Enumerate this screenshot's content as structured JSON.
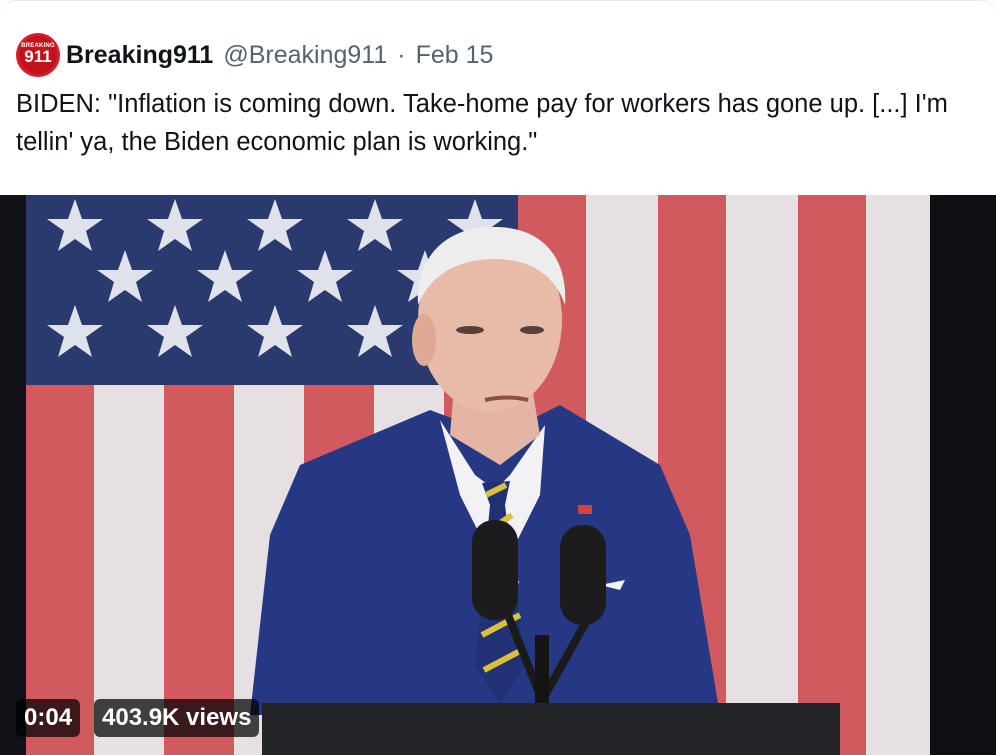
{
  "tweet": {
    "author_name": "Breaking911",
    "author_handle": "@Breaking911",
    "separator": "·",
    "date": "Feb 15",
    "avatar_top_text": "BREAKING",
    "avatar_number": "911",
    "text": "BIDEN: \"Inflation is coming down. Take-home pay for workers has gone up. [...] I'm tellin' ya, the Biden economic plan is working.\""
  },
  "video": {
    "timestamp": "0:04",
    "views": "403.9K views"
  },
  "colors": {
    "flag_red": "#c84a4f",
    "flag_white": "#e8e3e4",
    "flag_blue": "#1f2f63",
    "suit_blue": "#283a8a",
    "avatar_red": "#c4121d"
  }
}
